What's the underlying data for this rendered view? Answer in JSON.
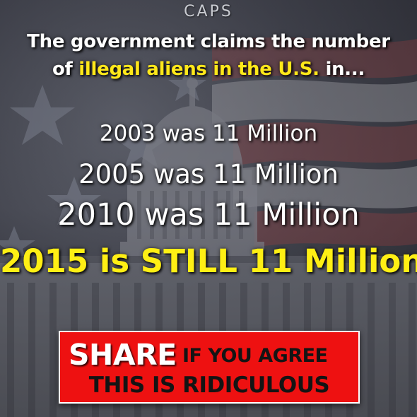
{
  "brand": "CAPS",
  "headline": {
    "line1": "The government claims the number",
    "line2_prefix": "of ",
    "line2_highlight": "illegal aliens in the U.S.",
    "line2_suffix": " in..."
  },
  "claims": [
    "2003 was 11 Million",
    "2005 was 11 Million",
    "2010 was 11 Million",
    "2015 is STILL 11 Million"
  ],
  "cta": {
    "share": "SHARE",
    "line1_rest": "IF YOU AGREE",
    "line2": "THIS IS RIDICULOUS"
  },
  "colors": {
    "highlight": "#ffe81a",
    "emphasis": "#ffef14",
    "cta_background": "#ee1111",
    "text": "#ffffff"
  }
}
